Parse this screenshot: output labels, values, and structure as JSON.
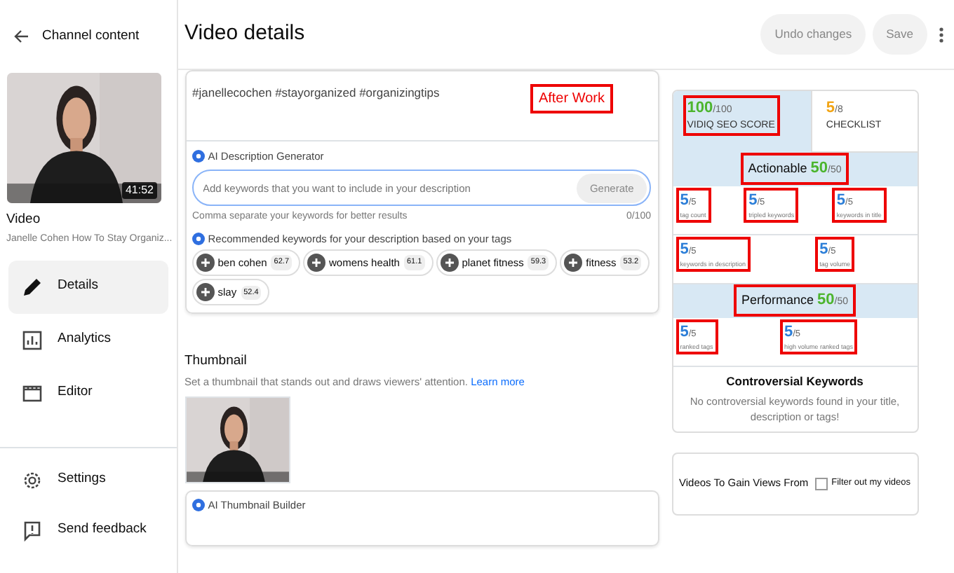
{
  "sidebar": {
    "back_label": "Channel content",
    "video_duration": "41:52",
    "video_heading": "Video",
    "video_title": "Janelle Cohen How To Stay Organiz...",
    "nav": [
      {
        "label": "Details",
        "kind": "pencil",
        "selected": true
      },
      {
        "label": "Analytics",
        "kind": "analytics",
        "selected": false
      },
      {
        "label": "Editor",
        "kind": "editor",
        "selected": false
      }
    ],
    "footer": [
      {
        "label": "Settings",
        "kind": "gear"
      },
      {
        "label": "Send feedback",
        "kind": "feedback"
      }
    ]
  },
  "header": {
    "title": "Video details",
    "buttons": [
      "Undo changes",
      "Save"
    ]
  },
  "description": {
    "text": "#janellecochen #stayorganized #organizingtips",
    "note": "After Work"
  },
  "ai_generator": {
    "title": "AI Description Generator",
    "placeholder": "Add keywords that you want to include in your description",
    "button": "Generate",
    "hint": "Comma separate your keywords for better results",
    "counter": "0/100",
    "recommend_title": "Recommended keywords for your description based on your tags",
    "keywords": [
      {
        "label": "ben cohen",
        "score": "62.7"
      },
      {
        "label": "womens health",
        "score": "61.1"
      },
      {
        "label": "planet fitness",
        "score": "59.3"
      },
      {
        "label": "fitness",
        "score": "53.2"
      },
      {
        "label": "slay",
        "score": "52.4"
      }
    ]
  },
  "thumbnail": {
    "title": "Thumbnail",
    "text": "Set a thumbnail that stands out and draws viewers' attention.",
    "link": "Learn more",
    "builder": "AI Thumbnail Builder"
  },
  "seo": {
    "tabs": [
      {
        "score": "100",
        "total": "/100",
        "label": "VIDIQ SEO SCORE",
        "selected": true,
        "annotated": true,
        "color": "#4cb52e"
      },
      {
        "score": "5",
        "total": "/8",
        "label": "CHECKLIST",
        "selected": false,
        "annotated": false,
        "color": "#f2a516"
      }
    ],
    "sections": [
      {
        "title": "Actionable",
        "score": "50",
        "total": "/50",
        "rows": [
          [
            {
              "score": "5",
              "total": "/5",
              "label": "tag count"
            },
            {
              "score": "5",
              "total": "/5",
              "label": "tripled keywords"
            },
            {
              "score": "5",
              "total": "/5",
              "label": "keywords in title"
            }
          ],
          [
            {
              "score": "5",
              "total": "/5",
              "label": "keywords in description"
            },
            {
              "score": "5",
              "total": "/5",
              "label": "tag volume"
            }
          ]
        ]
      },
      {
        "title": "Performance",
        "score": "50",
        "total": "/50",
        "rows": [
          [
            {
              "score": "5",
              "total": "/5",
              "label": "ranked tags"
            },
            {
              "score": "5",
              "total": "/5",
              "label": "high volume ranked tags"
            }
          ]
        ]
      }
    ],
    "controversial": {
      "title": "Controversial Keywords",
      "text": "No controversial keywords found in your title, description or tags!"
    },
    "videos": {
      "title": "Videos To Gain Views From",
      "filter_label": "Filter out my videos",
      "checked": false
    }
  }
}
